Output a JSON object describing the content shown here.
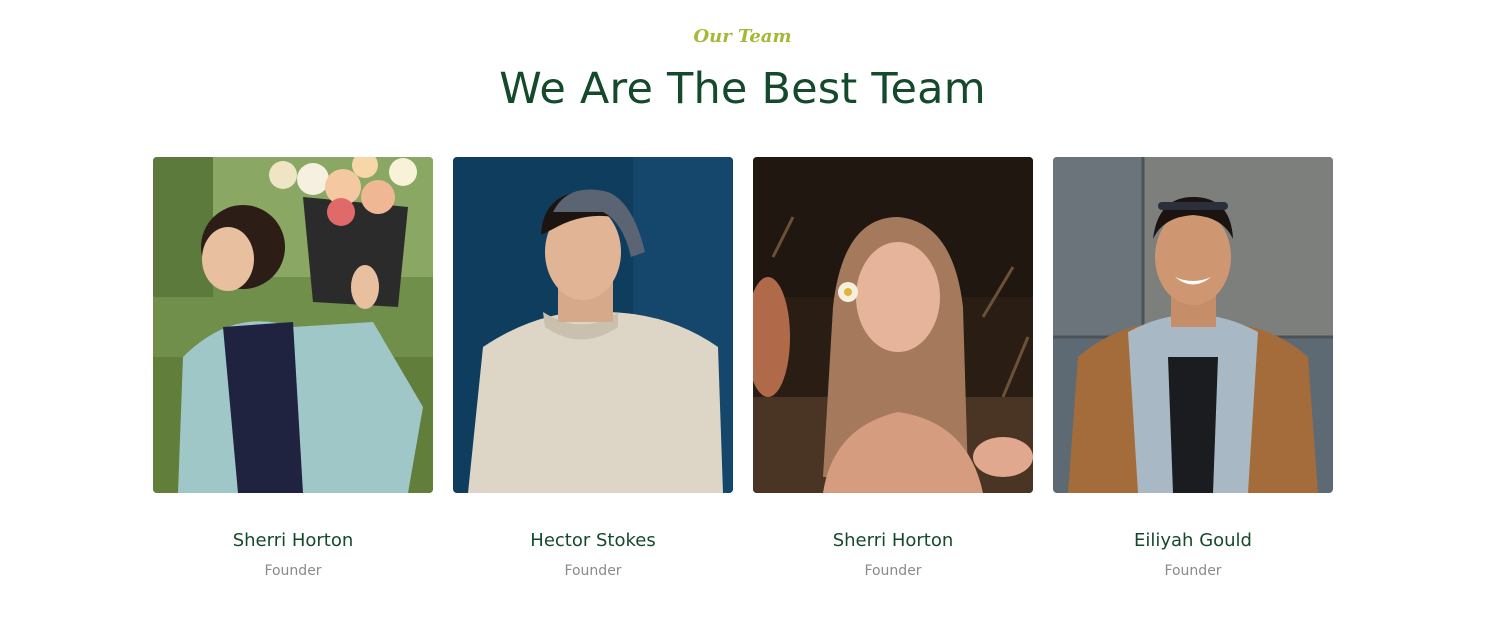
{
  "section": {
    "eyebrow": "Our Team",
    "title": "We Are The Best Team"
  },
  "members": [
    {
      "name": "Sherri Horton",
      "role": "Founder",
      "photo_icon": "woman-with-flower-bucket-photo"
    },
    {
      "name": "Hector Stokes",
      "role": "Founder",
      "photo_icon": "man-in-cap-photo"
    },
    {
      "name": "Sherri Horton",
      "role": "Founder",
      "photo_icon": "woman-in-field-photo"
    },
    {
      "name": "Eiliyah Gould",
      "role": "Founder",
      "photo_icon": "smiling-man-jacket-photo"
    }
  ],
  "colors": {
    "eyebrow": "#a6b836",
    "title": "#144a2b",
    "name": "#144a2b",
    "role": "#8a8a8a"
  }
}
